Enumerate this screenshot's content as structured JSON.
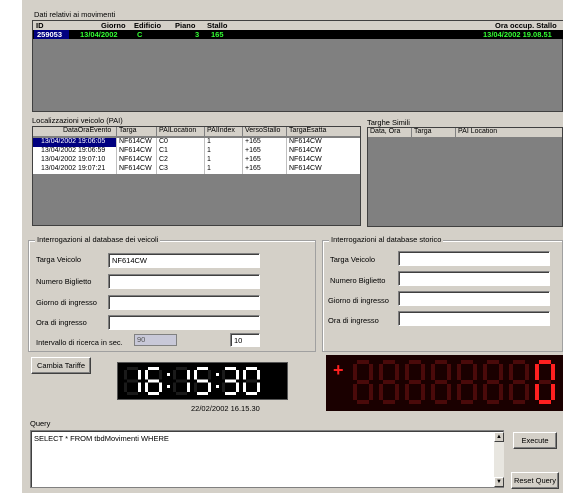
{
  "movements": {
    "title": "Dati relativi ai movimenti",
    "headers": [
      "ID",
      "Giorno",
      "Edificio",
      "Piano",
      "Stallo",
      "Ora occup. Stallo"
    ],
    "row": {
      "id": "259053",
      "giorno": "13/04/2002",
      "edificio": "C",
      "piano": "3",
      "stallo": "165",
      "ora": "13/04/2002 19.08.51"
    }
  },
  "localizations": {
    "title": "Localizzazioni veicolo (PAI)",
    "headers": [
      "DataOraEvento",
      "Targa",
      "PAILocation",
      "PAIIndex",
      "VersoStallo",
      "TargaEsatta"
    ],
    "rows": [
      [
        "13/04/2002 19:06:05",
        "NF614CW",
        "C0",
        "1",
        "+165",
        "NF614CW"
      ],
      [
        "13/04/2002 19:06:59",
        "NF614CW",
        "C1",
        "1",
        "+165",
        "NF614CW"
      ],
      [
        "13/04/2002 19:07:10",
        "NF614CW",
        "C2",
        "1",
        "+165",
        "NF614CW"
      ],
      [
        "13/04/2002 19:07:21",
        "NF614CW",
        "C3",
        "1",
        "+165",
        "NF614CW"
      ]
    ]
  },
  "similar": {
    "title": "Targhe Simili",
    "headers": [
      "Data, Ora",
      "Targa",
      "PAI Location"
    ]
  },
  "vehicle_query": {
    "title": "Interrogazioni al database dei veicoli",
    "targa_label": "Targa Veicolo",
    "targa_value": "NF614CW",
    "biglietto_label": "Numero Biglietto",
    "giorno_label": "Giorno di ingresso",
    "ora_label": "Ora di ingresso",
    "intervallo_label": "Intervallo di ricerca in sec.",
    "intervallo_value": "90",
    "intervallo_input": "10"
  },
  "history_query": {
    "title": "Interrogazioni al database storico",
    "targa_label": "Targa Veicolo",
    "biglietto_label": "Numero Biglietto",
    "giorno_label": "Giorno di ingresso",
    "ora_label": "Ora di ingresso"
  },
  "cambia_label": "Cambia Tariffe",
  "clock": {
    "digits": "16:15:30",
    "datetime": "22/02/2002 16.15.30"
  },
  "counter": {
    "sign": "+",
    "value": "0"
  },
  "query": {
    "label": "Query",
    "text": "SELECT * FROM tbdMovimenti WHERE",
    "execute_label": "Execute",
    "reset_label": "Reset Query"
  },
  "colors": {
    "window": "#d4d0c8",
    "selection": "#000080",
    "green_text": "#33ff33",
    "led_red": "#ff2020"
  }
}
